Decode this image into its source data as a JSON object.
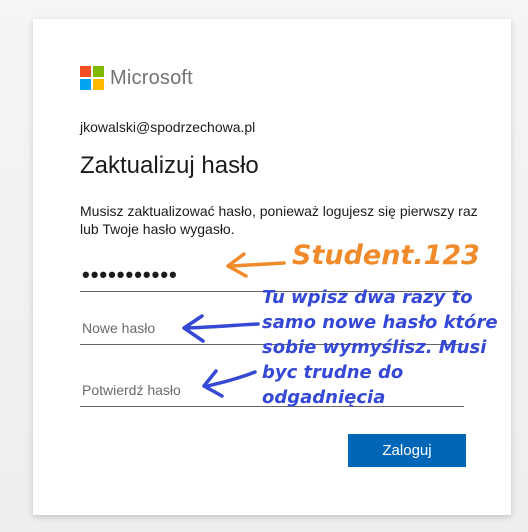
{
  "brand": {
    "name": "Microsoft",
    "colors": [
      "#f25022",
      "#7fba00",
      "#00a4ef",
      "#ffb900"
    ]
  },
  "account": {
    "email": "jkowalski@spodrzechowa.pl"
  },
  "page": {
    "title": "Zaktualizuj hasło",
    "description": "Musisz zaktualizować hasło, ponieważ logujesz się pierwszy raz lub Twoje hasło wygasło."
  },
  "form": {
    "current_password_value": "•••••••••••",
    "new_password_placeholder": "Nowe hasło",
    "confirm_password_placeholder": "Potwierdź hasło",
    "submit_label": "Zaloguj"
  },
  "annotations": {
    "password_hint": "Student.123",
    "instructions": "Tu wpisz dwa razy to samo nowe hasło które sobie wymyślisz. Musi byc trudne do odgadnięcia",
    "orange_color": "#f08a2b",
    "blue_color": "#3548d6"
  },
  "colors": {
    "accent": "#0067b8",
    "background": "#f2f2f2"
  }
}
